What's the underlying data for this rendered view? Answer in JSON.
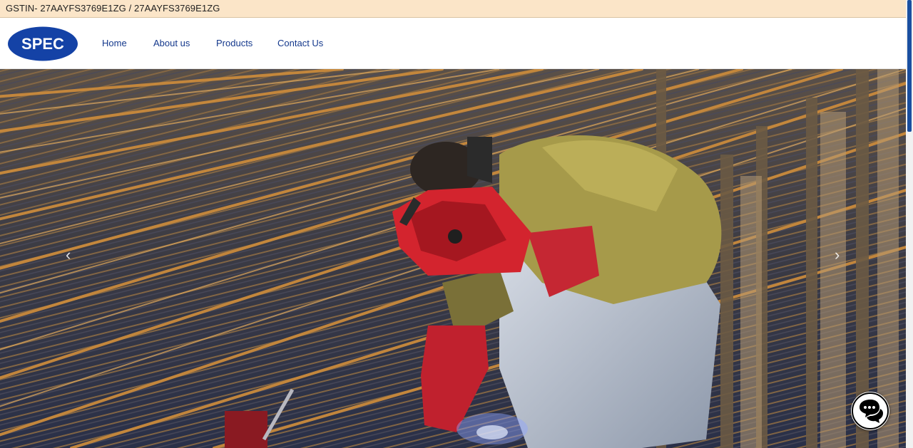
{
  "topbar": {
    "gstin_text": "GSTIN- 27AAYFS3769E1ZG / 27AAYFS3769E1ZG"
  },
  "brand": {
    "logo_text": "SPEC",
    "logo_color": "#1442a6"
  },
  "nav": {
    "items": [
      {
        "label": "Home"
      },
      {
        "label": "About us"
      },
      {
        "label": "Products"
      },
      {
        "label": "Contact Us"
      }
    ]
  },
  "hero": {
    "prev_icon": "chevron-left-icon",
    "next_icon": "chevron-right-icon"
  },
  "chat": {
    "icon": "chat-bubbles-icon"
  },
  "colors": {
    "topbar_bg": "#fbe5c8",
    "nav_link": "#14388c",
    "scroll_thumb": "#1a4fa0"
  }
}
